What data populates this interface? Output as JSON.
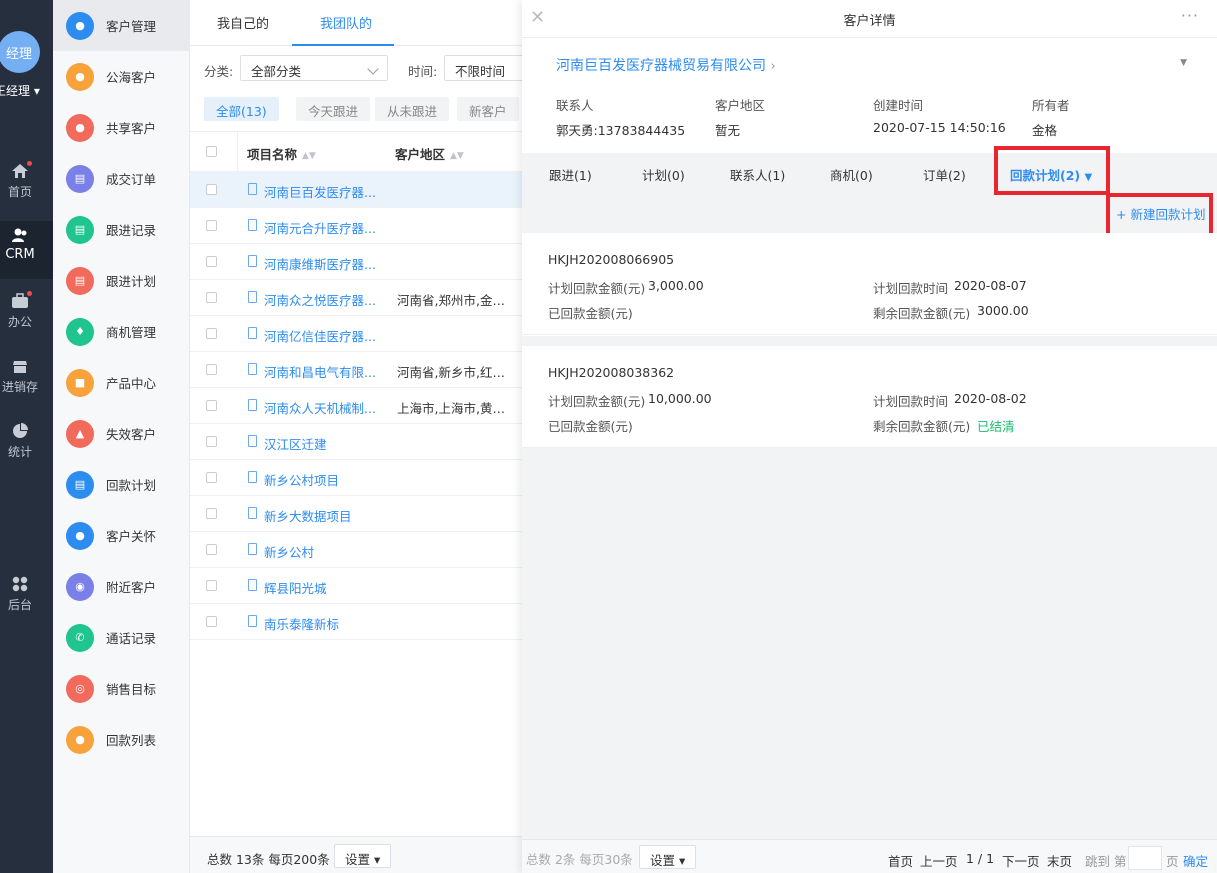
{
  "rail": {
    "avatar_text": "经理",
    "user_name": "王经理",
    "items": [
      {
        "label": "首页",
        "badge": true
      },
      {
        "label": "CRM",
        "badge": false
      },
      {
        "label": "办公",
        "badge": true
      },
      {
        "label": "进销存",
        "badge": false
      },
      {
        "label": "统计",
        "badge": false
      },
      {
        "label": "后台",
        "badge": false
      }
    ]
  },
  "menu": {
    "items": [
      {
        "label": "客户管理",
        "color": "#2d8cf0",
        "icon": "customers-icon"
      },
      {
        "label": "公海客户",
        "color": "#f7a23b",
        "icon": "public-customer-icon"
      },
      {
        "label": "共享客户",
        "color": "#f26a5b",
        "icon": "shared-customer-icon"
      },
      {
        "label": "成交订单",
        "color": "#7b7fe8",
        "icon": "order-icon"
      },
      {
        "label": "跟进记录",
        "color": "#1fc48e",
        "icon": "record-icon"
      },
      {
        "label": "跟进计划",
        "color": "#f26a5b",
        "icon": "plan-icon"
      },
      {
        "label": "商机管理",
        "color": "#1fc48e",
        "icon": "opportunity-icon"
      },
      {
        "label": "产品中心",
        "color": "#f7a23b",
        "icon": "product-icon"
      },
      {
        "label": "失效客户",
        "color": "#f26a5b",
        "icon": "invalid-customer-icon"
      },
      {
        "label": "回款计划",
        "color": "#2d8cf0",
        "icon": "payment-plan-icon"
      },
      {
        "label": "客户关怀",
        "color": "#2d8cf0",
        "icon": "care-icon"
      },
      {
        "label": "附近客户",
        "color": "#7b7fe8",
        "icon": "nearby-icon"
      },
      {
        "label": "通话记录",
        "color": "#1fc48e",
        "icon": "call-icon"
      },
      {
        "label": "销售目标",
        "color": "#f26a5b",
        "icon": "target-icon"
      },
      {
        "label": "回款列表",
        "color": "#f7a23b",
        "icon": "payment-list-icon"
      }
    ]
  },
  "list": {
    "tabs": [
      "我自己的",
      "我团队的"
    ],
    "filter_category_label": "分类:",
    "filter_category_value": "全部分类",
    "filter_time_label": "时间:",
    "filter_time_value": "不限时间",
    "chips": [
      "全部(13)",
      "今天跟进",
      "从未跟进",
      "新客户"
    ],
    "columns": [
      "项目名称",
      "客户地区"
    ],
    "rows": [
      {
        "name": "河南巨百发医疗器...",
        "region": ""
      },
      {
        "name": "河南元合升医疗器...",
        "region": ""
      },
      {
        "name": "河南康维斯医疗器...",
        "region": ""
      },
      {
        "name": "河南众之悦医疗器...",
        "region": "河南省,郑州市,金水..."
      },
      {
        "name": "河南亿信佳医疗器...",
        "region": ""
      },
      {
        "name": "河南和昌电气有限...",
        "region": "河南省,新乡市,红旗..."
      },
      {
        "name": "河南众人天机械制...",
        "region": "上海市,上海市,黄浦..."
      },
      {
        "name": "汉江区迁建",
        "region": ""
      },
      {
        "name": "新乡公村项目",
        "region": ""
      },
      {
        "name": "新乡大数据项目",
        "region": ""
      },
      {
        "name": "新乡公村",
        "region": ""
      },
      {
        "name": "辉县阳光城",
        "region": ""
      },
      {
        "name": "南乐泰隆新标",
        "region": ""
      }
    ],
    "footer_total": "总数 13条 每页200条",
    "footer_settings": "设置"
  },
  "detail": {
    "title": "客户详情",
    "more": "···",
    "company": "河南巨百发医疗器械贸易有限公司",
    "fields": [
      {
        "label": "联系人",
        "value": "郭天勇:13783844435"
      },
      {
        "label": "客户地区",
        "value": "暂无"
      },
      {
        "label": "创建时间",
        "value": "2020-07-15 14:50:16"
      },
      {
        "label": "所有者",
        "value": "金格"
      }
    ],
    "tabs": [
      "跟进(1)",
      "计划(0)",
      "联系人(1)",
      "商机(0)",
      "订单(2)",
      "回款计划(2)"
    ],
    "new_plan": "+ 新建回款计划",
    "plans": [
      {
        "id": "HKJH202008066905",
        "plan_amount_label": "计划回款金额(元)",
        "plan_amount": "3,000.00",
        "plan_time_label": "计划回款时间",
        "plan_time": "2020-08-07",
        "paid_label": "已回款金额(元)",
        "remain_label": "剩余回款金额(元)",
        "remain": "3000.00"
      },
      {
        "id": "HKJH202008038362",
        "plan_amount_label": "计划回款金额(元)",
        "plan_amount": "10,000.00",
        "plan_time_label": "计划回款时间",
        "plan_time": "2020-08-02",
        "paid_label": "已回款金额(元)",
        "remain_label": "剩余回款金额(元)",
        "remain": "已结清"
      }
    ],
    "footer": {
      "total": "总数 2条 每页30条",
      "settings": "设置",
      "first": "首页",
      "prev": "上一页",
      "page": "1 / 1",
      "next": "下一页",
      "last": "末页",
      "jump": "跳到 第",
      "page_unit": "页",
      "confirm": "确定"
    }
  }
}
